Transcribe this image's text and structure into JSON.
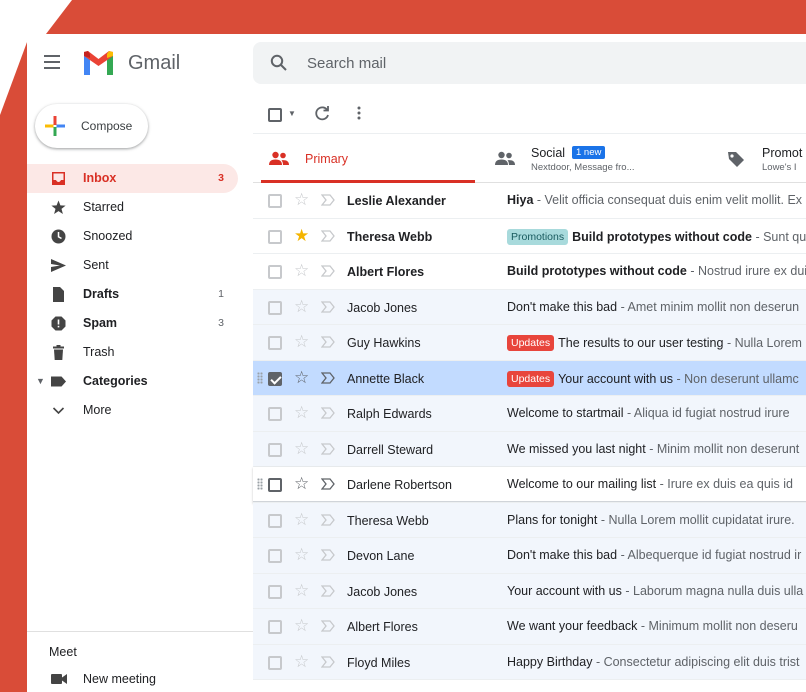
{
  "app": {
    "name": "Gmail"
  },
  "search": {
    "placeholder": "Search mail"
  },
  "compose": {
    "label": "Compose"
  },
  "nav": [
    {
      "key": "inbox",
      "label": "Inbox",
      "count": "3"
    },
    {
      "key": "starred",
      "label": "Starred",
      "count": ""
    },
    {
      "key": "snoozed",
      "label": "Snoozed",
      "count": ""
    },
    {
      "key": "sent",
      "label": "Sent",
      "count": ""
    },
    {
      "key": "drafts",
      "label": "Drafts",
      "count": "1"
    },
    {
      "key": "spam",
      "label": "Spam",
      "count": "3"
    },
    {
      "key": "trash",
      "label": "Trash",
      "count": ""
    },
    {
      "key": "categories",
      "label": "Categories",
      "count": ""
    },
    {
      "key": "more",
      "label": "More",
      "count": ""
    }
  ],
  "meet": {
    "title": "Meet",
    "new_meeting": "New meeting"
  },
  "tabs": {
    "primary": {
      "label": "Primary"
    },
    "social": {
      "label": "Social",
      "badge": "1 new",
      "sub": "Nextdoor, Message fro..."
    },
    "promotions": {
      "label": "Promot",
      "sub": "Lowe's I"
    }
  },
  "emails": [
    {
      "sender": "Leslie Alexander",
      "label": "",
      "subject": "Hiya",
      "snippet": "Velit officia consequat duis enim velit mollit. Ex"
    },
    {
      "sender": "Theresa Webb",
      "label": "Promotions",
      "subject": "Build prototypes without code",
      "snippet": "Sunt qui"
    },
    {
      "sender": "Albert Flores",
      "label": "",
      "subject": "Build prototypes without code",
      "snippet": "Nostrud irure ex duis"
    },
    {
      "sender": "Jacob Jones",
      "label": "",
      "subject": "Don't make this bad",
      "snippet": "Amet minim mollit non deserun"
    },
    {
      "sender": "Guy Hawkins",
      "label": "Updates",
      "subject": "The results to our user testing",
      "snippet": "Nulla Lorem"
    },
    {
      "sender": "Annette Black",
      "label": "Updates",
      "subject": "Your account with us",
      "snippet": "Non deserunt ullamc"
    },
    {
      "sender": "Ralph Edwards",
      "label": "",
      "subject": "Welcome to startmail",
      "snippet": "Aliqua id fugiat nostrud irure"
    },
    {
      "sender": "Darrell Steward",
      "label": "",
      "subject": "We missed you last night",
      "snippet": "Minim mollit non deserunt"
    },
    {
      "sender": "Darlene Robertson",
      "label": "",
      "subject": "Welcome to our mailing list",
      "snippet": "Irure ex duis ea quis id"
    },
    {
      "sender": "Theresa Webb",
      "label": "",
      "subject": "Plans for tonight",
      "snippet": "Nulla Lorem mollit cupidatat irure."
    },
    {
      "sender": "Devon Lane",
      "label": "",
      "subject": "Don't make this bad",
      "snippet": "Albequerque id fugiat nostrud ir"
    },
    {
      "sender": "Jacob Jones",
      "label": "",
      "subject": "Your account with us",
      "snippet": "Laborum magna nulla duis ulla"
    },
    {
      "sender": "Albert Flores",
      "label": "",
      "subject": "We want your feedback",
      "snippet": "Minimum mollit non deseru"
    },
    {
      "sender": "Floyd Miles",
      "label": "",
      "subject": "Happy Birthday",
      "snippet": "Consectetur adipiscing elit duis trist"
    }
  ],
  "colors": {
    "accent": "#d93025",
    "background_shape": "#d94c38",
    "selected_row": "#c2dbff",
    "star": "#f4b400"
  }
}
